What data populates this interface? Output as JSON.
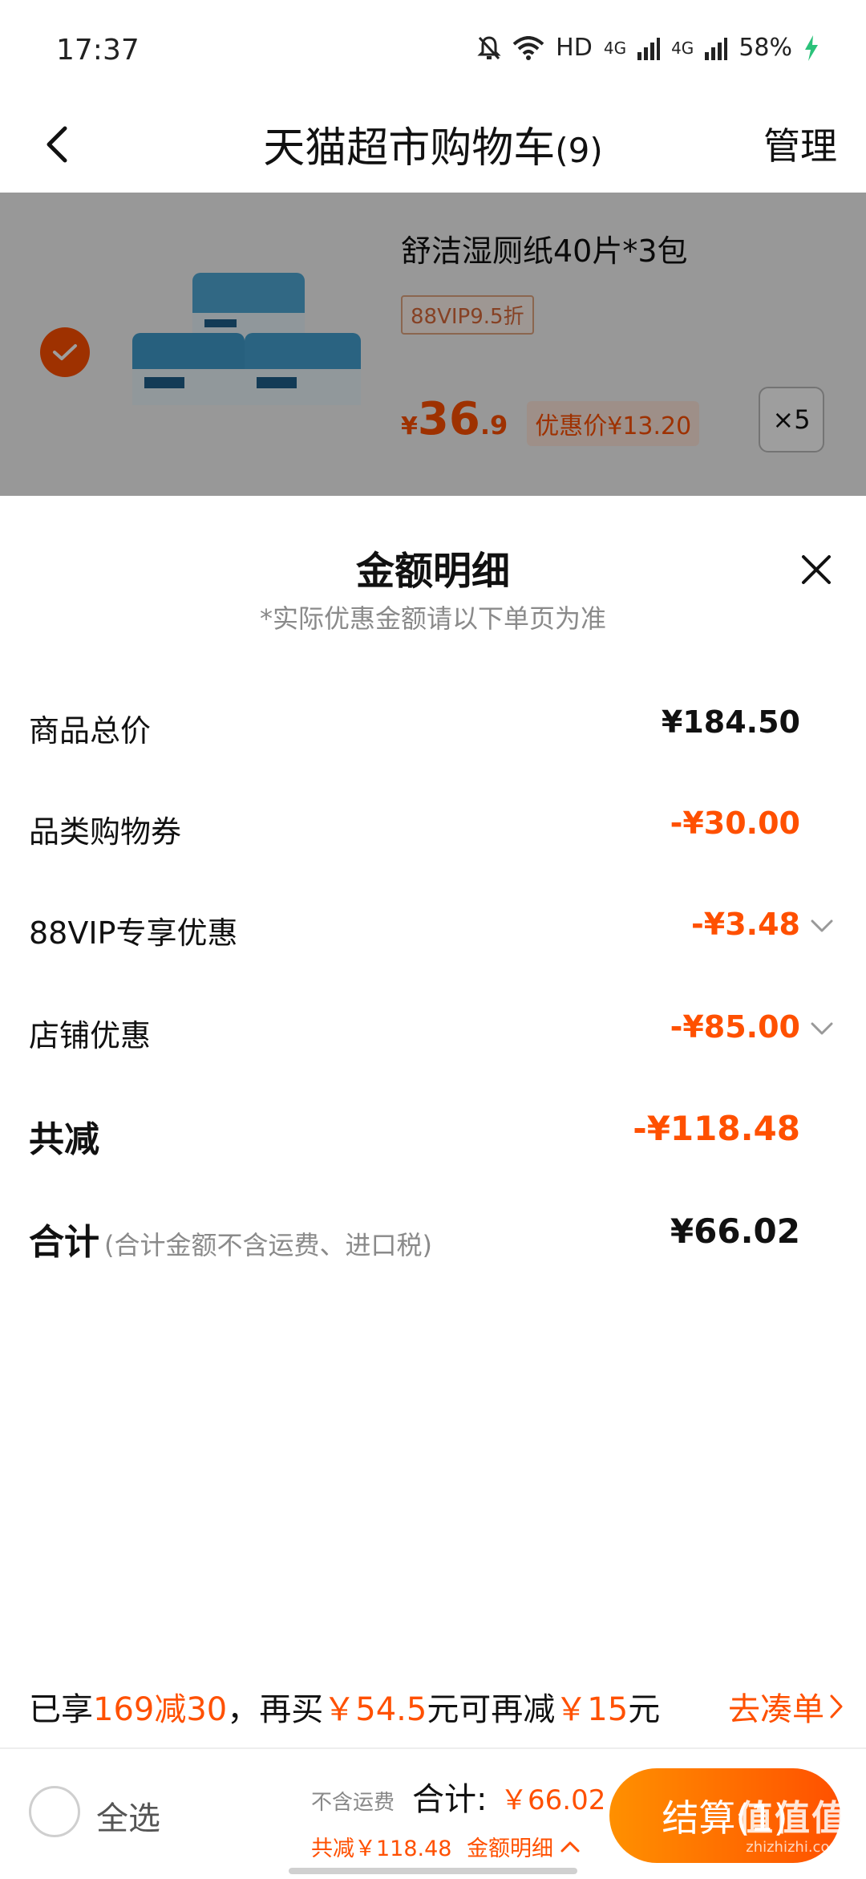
{
  "status_bar": {
    "time": "17:37",
    "network_label": "HD",
    "signal1": "4G",
    "signal2": "4G",
    "battery": "58%",
    "icons": [
      "bell-off-icon",
      "wifi-icon",
      "signal-icon",
      "battery-charging-icon"
    ]
  },
  "header": {
    "title": "天猫超市购物车",
    "count": "(9)",
    "manage": "管理",
    "back_icon": "chevron-left-icon"
  },
  "cart_item": {
    "name": "舒洁湿厕纸40片*3包",
    "vip_tag": "88VIP9.5折",
    "price_yen": "¥",
    "price_int": "36",
    "price_dec": ".9",
    "promo_price": "优惠价¥13.20",
    "quantity": "×5",
    "selected": true
  },
  "sheet": {
    "title": "金额明细",
    "subtitle": "*实际优惠金额请以下单页为准",
    "rows": [
      {
        "label": "商品总价",
        "value": "¥184.50"
      },
      {
        "label": "品类购物券",
        "value": "-¥30.00"
      },
      {
        "label": "88VIP专享优惠",
        "value": "-¥3.48"
      },
      {
        "label": "店铺优惠",
        "value": "-¥85.00"
      },
      {
        "label": "共减",
        "value": "-¥118.48"
      },
      {
        "label": "合计",
        "sub": "(合计金额不含运费、进口税)",
        "value": "¥66.02"
      }
    ]
  },
  "promo_banner": {
    "part1": "已享",
    "deal": "169减30",
    "part2": "，再买",
    "amount1": "￥54.5",
    "part3": "元可再减",
    "amount2": "￥15",
    "part4": "元",
    "link": "去凑单"
  },
  "bottom_bar": {
    "select_all": "全选",
    "shipping_note": "不含运费",
    "total_label": "合计:",
    "total_value": "￥66.02",
    "saved": "共减￥118.48",
    "detail_link": "金额明细",
    "checkout": "结算(1)",
    "watermark": "值值值",
    "watermark_sub": "zhizhizhi.com"
  },
  "colors": {
    "accent": "#ff5000",
    "accent_light": "#ff9000",
    "text_muted": "#8a8a8a"
  }
}
